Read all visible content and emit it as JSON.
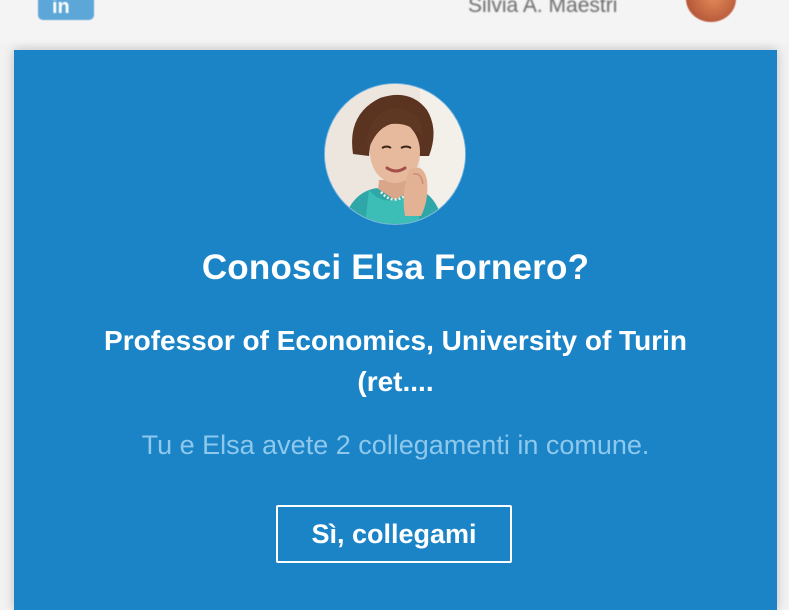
{
  "header": {
    "logo_text": "in",
    "user_name": "Silvia A. Maestri"
  },
  "suggestion_card": {
    "title": "Conosci Elsa Fornero?",
    "headline": "Professor of Economics, University of Turin (ret....",
    "mutual_connections": "Tu e Elsa avete 2 collegamenti in comune.",
    "connect_button_label": "Sì, collegami"
  },
  "colors": {
    "card_background": "#1a84c7",
    "secondary_text": "#8ec8ec",
    "primary_text": "#ffffff"
  }
}
